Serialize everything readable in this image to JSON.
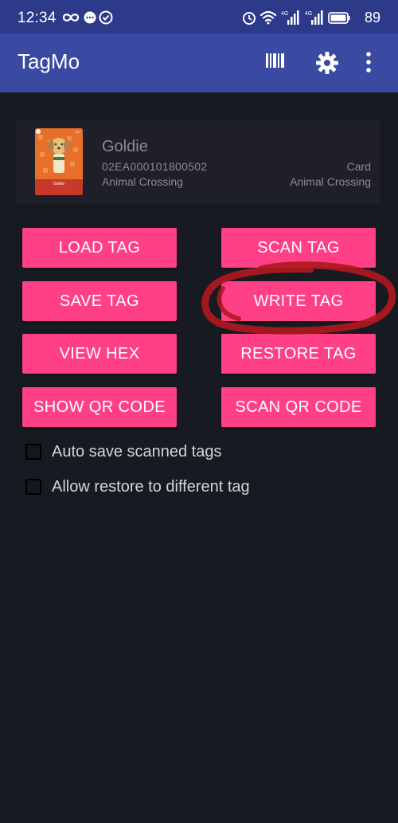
{
  "status_bar": {
    "time": "12:34",
    "battery": "89",
    "network_label": "4G"
  },
  "app_bar": {
    "title": "TagMo",
    "icons": [
      "barcode-icon",
      "gear-icon",
      "more-vert-icon"
    ]
  },
  "tag_card": {
    "name": "Goldie",
    "id": "02EA000101800502",
    "series": "Animal Crossing",
    "type": "Card",
    "game": "Animal Crossing",
    "image": {
      "card_name": "Goldie",
      "number": "017",
      "colors": {
        "card": "#e86f2a",
        "band": "#c73a2a",
        "dog": "#e9c07a"
      }
    }
  },
  "buttons": {
    "load_tag": "LOAD TAG",
    "scan_tag": "SCAN TAG",
    "save_tag": "SAVE TAG",
    "write_tag": "WRITE TAG",
    "view_hex": "VIEW HEX",
    "restore_tag": "RESTORE TAG",
    "show_qr_code": "SHOW QR CODE",
    "scan_qr_code": "SCAN QR CODE"
  },
  "options": {
    "auto_save": {
      "label": "Auto save scanned tags",
      "checked": false
    },
    "allow_restore": {
      "label": "Allow restore to different tag",
      "checked": false
    }
  },
  "colors": {
    "accent": "#ff4087",
    "app_bar": "#3a4aa2",
    "status_bar": "#2d3a8a",
    "background": "#181a22",
    "annotation": "#b0181e"
  }
}
